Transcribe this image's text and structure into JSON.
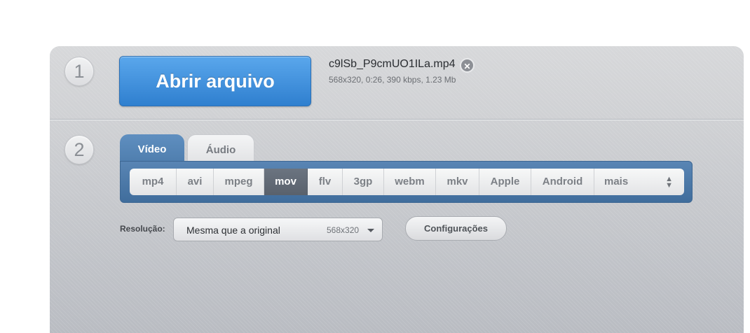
{
  "step1": {
    "number": "1",
    "open_button": "Abrir arquivo"
  },
  "file": {
    "name": "c9lSb_P9cmUO1ILa.mp4",
    "meta": "568x320, 0:26, 390 kbps, 1.23 Mb",
    "remove_icon": "close-circle-icon"
  },
  "step2": {
    "number": "2"
  },
  "tabs": [
    {
      "label": "Vídeo",
      "active": true
    },
    {
      "label": "Áudio",
      "active": false
    }
  ],
  "formats": [
    "mp4",
    "avi",
    "mpeg",
    "mov",
    "flv",
    "3gp",
    "webm",
    "mkv",
    "Apple",
    "Android",
    "mais"
  ],
  "active_format": "mov",
  "resolution": {
    "label": "Resolução:",
    "value": "Mesma que a original",
    "dimensions": "568x320"
  },
  "settings_button": "Configurações",
  "colors": {
    "accent_blue": "#3a8ad8",
    "tab_active": "#5384b5",
    "format_active": "#616a75"
  }
}
